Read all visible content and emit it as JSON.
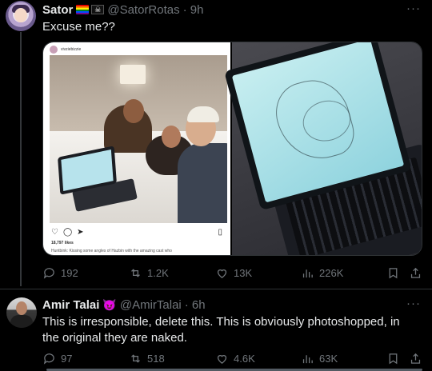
{
  "post1": {
    "display_name": "Sator",
    "handle": "@SatorRotas",
    "time": "· 9h",
    "text": "Excuse me??",
    "more": "···",
    "stats": {
      "replies": "192",
      "reposts": "1.2K",
      "likes": "13K",
      "views": "226K"
    },
    "embedded_instagram": {
      "username": "vivziebizzie",
      "likes": "18,797 likes",
      "caption": "Huntbink: Kissing some angles of Hazbin with the amazing cast who"
    }
  },
  "post2": {
    "display_name": "Amir Talai",
    "badge": "😈",
    "handle": "@AmirTalai",
    "time": "· 6h",
    "text": "This is irresponsible, delete this. This is obviously photoshopped, in the original they are naked.",
    "more": "···",
    "stats": {
      "replies": "97",
      "reposts": "518",
      "likes": "4.6K",
      "views": "63K"
    }
  },
  "icons": [
    "reply-icon",
    "repost-icon",
    "like-icon",
    "views-icon",
    "bookmark-icon",
    "share-icon",
    "more-icon"
  ],
  "colors": {
    "background": "#000000",
    "text": "#e7e9ea",
    "muted": "#71767b",
    "divider": "#2f3336"
  }
}
